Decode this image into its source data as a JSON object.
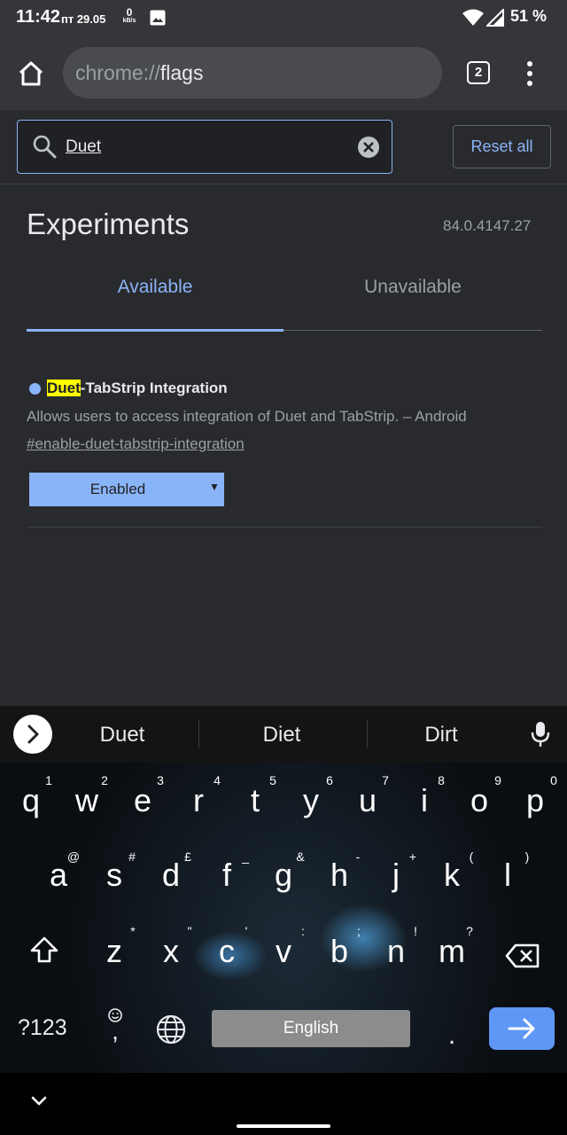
{
  "status_bar": {
    "time": "11:42",
    "date": "пт 29.05",
    "speed_value": "0",
    "speed_unit": "kB/s",
    "battery": "51 %"
  },
  "toolbar": {
    "url_scheme": "chrome://",
    "url_host": "flags",
    "tab_count": "2"
  },
  "search": {
    "value": "Duet",
    "reset_label": "Reset all"
  },
  "page": {
    "title": "Experiments",
    "version": "84.0.4147.27",
    "tabs": [
      {
        "label": "Available",
        "selected": true
      },
      {
        "label": "Unavailable",
        "selected": false
      }
    ]
  },
  "flag": {
    "name_highlight": "Duet",
    "name_rest": "-TabStrip Integration",
    "description": "Allows users to access integration of Duet and TabStrip. – Android",
    "link": "#enable-duet-tabstrip-integration",
    "state": "Enabled"
  },
  "keyboard": {
    "suggestions": [
      "Duet",
      "Diet",
      "Dirt"
    ],
    "row1": [
      {
        "key": "q",
        "hint": "1"
      },
      {
        "key": "w",
        "hint": "2"
      },
      {
        "key": "e",
        "hint": "3"
      },
      {
        "key": "r",
        "hint": "4"
      },
      {
        "key": "t",
        "hint": "5"
      },
      {
        "key": "y",
        "hint": "6"
      },
      {
        "key": "u",
        "hint": "7"
      },
      {
        "key": "i",
        "hint": "8"
      },
      {
        "key": "o",
        "hint": "9"
      },
      {
        "key": "p",
        "hint": "0"
      }
    ],
    "row2": [
      {
        "key": "a",
        "hint": "@"
      },
      {
        "key": "s",
        "hint": "#"
      },
      {
        "key": "d",
        "hint": "£"
      },
      {
        "key": "f",
        "hint": "_"
      },
      {
        "key": "g",
        "hint": "&"
      },
      {
        "key": "h",
        "hint": "-"
      },
      {
        "key": "j",
        "hint": "+"
      },
      {
        "key": "k",
        "hint": "("
      },
      {
        "key": "l",
        "hint": ")"
      }
    ],
    "row3": [
      {
        "key": "z",
        "hint": "*"
      },
      {
        "key": "x",
        "hint": "\""
      },
      {
        "key": "c",
        "hint": "'"
      },
      {
        "key": "v",
        "hint": ":"
      },
      {
        "key": "b",
        "hint": ";"
      },
      {
        "key": "n",
        "hint": "!"
      },
      {
        "key": "m",
        "hint": "?"
      }
    ],
    "symbols_label": "?123",
    "comma": ",",
    "space_label": "English",
    "period": "."
  },
  "colors": {
    "accent": "#8ab4f8",
    "highlight": "#ffff00",
    "enter_key": "#5e97f6"
  }
}
